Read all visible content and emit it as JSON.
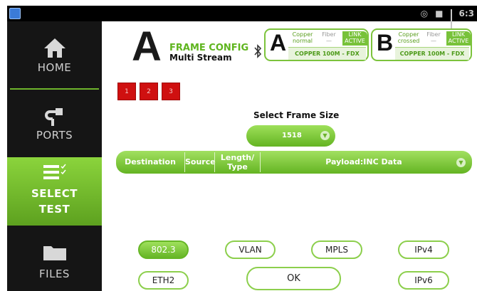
{
  "status_bar": {
    "time": "6:3"
  },
  "sidebar": {
    "items": [
      {
        "label": "HOME"
      },
      {
        "label": "PORTS"
      },
      {
        "label_line1": "SELECT",
        "label_line2": "TEST"
      },
      {
        "label": "FILES"
      }
    ]
  },
  "header": {
    "big_letter": "A",
    "title": "FRAME CONFIG",
    "subtitle": "Multi Stream"
  },
  "ports": [
    {
      "letter": "A",
      "cell1": [
        "Copper",
        "normal"
      ],
      "cell2": [
        "Fiber",
        "—"
      ],
      "cell3": [
        "LINK",
        "ACTIVE"
      ],
      "status": "COPPER 100M  - FDX"
    },
    {
      "letter": "B",
      "cell1": [
        "Copper",
        "crossed"
      ],
      "cell2": [
        "Fiber",
        "—"
      ],
      "cell3": [
        "LINK",
        "ACTIVE"
      ],
      "status": "COPPER 100M  - FDX"
    }
  ],
  "streams": [
    "1",
    "2",
    "3"
  ],
  "frame_size": {
    "label": "Select Frame Size",
    "value": "1518"
  },
  "table_header": {
    "destination": "Destination",
    "source": "Source",
    "length_type_1": "Length/",
    "length_type_2": "Type",
    "payload": "Payload:INC Data"
  },
  "protocols": {
    "b8023": "802.3",
    "vlan": "VLAN",
    "mpls": "MPLS",
    "ipv4": "IPv4",
    "eth2": "ETH2",
    "ok": "OK",
    "ipv6": "IPv6"
  },
  "colors": {
    "accent": "#6fb52c",
    "stream_tab": "#cf1010",
    "sidebar_bg": "#151515"
  }
}
